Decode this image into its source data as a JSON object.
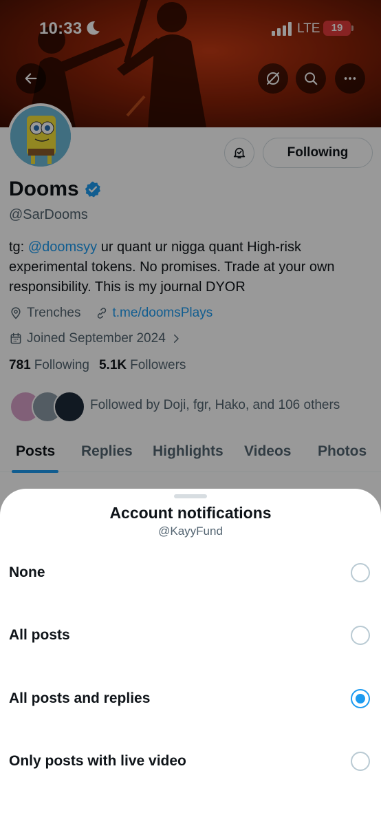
{
  "status_bar": {
    "time": "10:33",
    "network": "LTE",
    "battery": "19"
  },
  "header": {
    "icons": [
      "arrow-left-icon",
      "eye-slash-icon",
      "search-icon",
      "more-icon"
    ],
    "accent": "#1d9bf0"
  },
  "profile": {
    "display_name": "Dooms",
    "handle": "@SarDooms",
    "bio_prefix": "tg: ",
    "bio_link": "@doomsyy",
    "bio_text": " ur quant ur nigga quant High-risk experimental tokens. No promises. Trade at your own responsibility. This is my journal DYOR",
    "location": "Trenches",
    "website": "t.me/doomsPlays",
    "joined": "Joined September 2024",
    "following_count": "781",
    "following_label": "Following",
    "followers_count": "5.1K",
    "followers_label": "Followers",
    "followed_by": "Followed by Doji, fgr, Hako, and 106 others",
    "follow_button": "Following"
  },
  "tabs": [
    "Posts",
    "Replies",
    "Highlights",
    "Videos",
    "Photos"
  ],
  "active_tab": "Posts",
  "sheet": {
    "title": "Account notifications",
    "subtitle": "@KayyFund",
    "options": [
      {
        "label": "None",
        "selected": false
      },
      {
        "label": "All posts",
        "selected": false
      },
      {
        "label": "All posts and replies",
        "selected": true
      },
      {
        "label": "Only posts with live video",
        "selected": false
      }
    ]
  }
}
